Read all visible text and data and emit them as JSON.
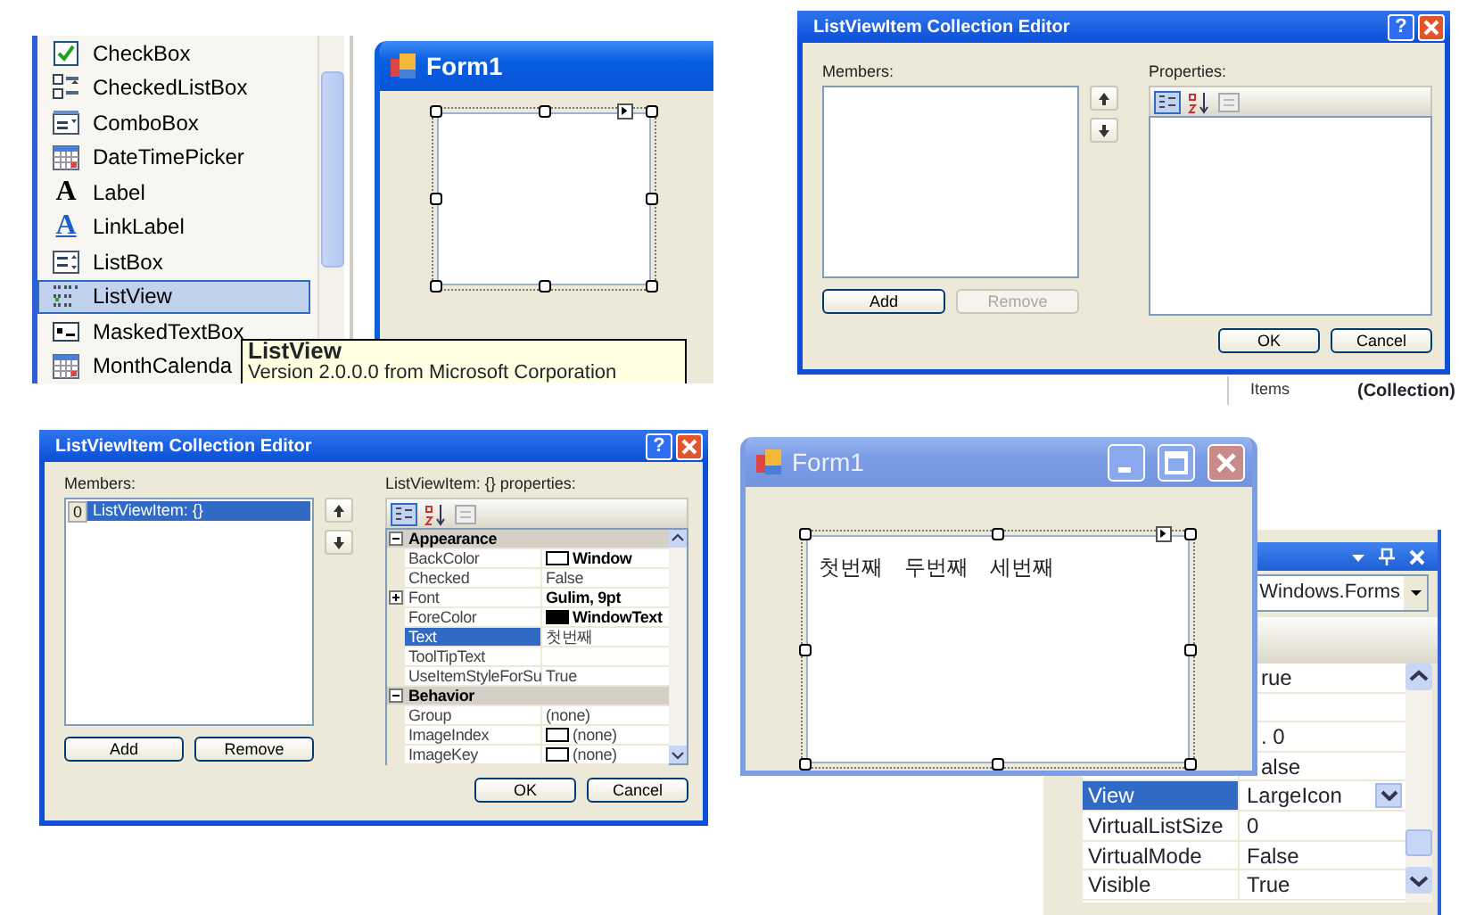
{
  "toolbox": {
    "items": [
      {
        "label": "CheckBox",
        "selected": false
      },
      {
        "label": "CheckedListBox",
        "selected": false
      },
      {
        "label": "ComboBox",
        "selected": false
      },
      {
        "label": "DateTimePicker",
        "selected": false
      },
      {
        "label": "Label",
        "glyph": "A",
        "selected": false
      },
      {
        "label": "LinkLabel",
        "glyph": "A",
        "selected": false
      },
      {
        "label": "ListBox",
        "selected": false
      },
      {
        "label": "ListView",
        "selected": true
      },
      {
        "label": "MaskedTextBox",
        "selected": false
      },
      {
        "label": "MonthCalenda",
        "selected": false
      }
    ]
  },
  "tooltip": {
    "title": "ListView",
    "text": "Version 2.0.0.0 from Microsoft Corporation"
  },
  "designer_form": {
    "title": "Form1"
  },
  "empty_editor": {
    "title": "ListViewItem Collection Editor",
    "help": "?",
    "members_label": "Members:",
    "properties_label": "Properties:",
    "buttons": [
      {
        "label": "Add",
        "disabled": false
      },
      {
        "label": "Remove",
        "disabled": true
      }
    ],
    "ok": "OK",
    "cancel": "Cancel"
  },
  "background_grid": {
    "name": "Items",
    "value": "(Collection)"
  },
  "item_editor": {
    "title": "ListViewItem Collection Editor",
    "help": "?",
    "members_label": "Members:",
    "members": [
      {
        "index": "0",
        "label": "ListViewItem: {}",
        "selected": true
      }
    ],
    "properties_label": "ListViewItem: {} properties:",
    "properties": [
      {
        "kind": "category",
        "name": "Appearance",
        "expanded": true
      },
      {
        "kind": "property",
        "name": "BackColor",
        "value": "Window",
        "bold": true,
        "color": "#ffffff",
        "selected": false
      },
      {
        "kind": "property",
        "name": "Checked",
        "value": "False",
        "bold": false,
        "selected": false
      },
      {
        "kind": "property",
        "name": "Font",
        "value": "Gulim, 9pt",
        "bold": true,
        "expandable": true,
        "selected": false
      },
      {
        "kind": "property",
        "name": "ForeColor",
        "value": "WindowText",
        "bold": true,
        "color": "#000000",
        "selected": false
      },
      {
        "kind": "property",
        "name": "Text",
        "value": "첫번째",
        "bold": false,
        "selected": true
      },
      {
        "kind": "property",
        "name": "ToolTipText",
        "selected": false
      },
      {
        "kind": "property",
        "name": "UseItemStyleForSu",
        "value": "True",
        "bold": false,
        "selected": false
      },
      {
        "kind": "category",
        "name": "Behavior",
        "expanded": true
      },
      {
        "kind": "property",
        "name": "Group",
        "value": "(none)",
        "bold": false,
        "selected": false
      },
      {
        "kind": "property",
        "name": "ImageIndex",
        "value": "(none)",
        "bold": false,
        "color": "#ffffff",
        "selected": false
      },
      {
        "kind": "property",
        "name": "ImageKey",
        "value": "(none)",
        "bold": false,
        "color": "#ffffff",
        "selected": false
      }
    ],
    "buttons": [
      {
        "label": "Add",
        "disabled": false
      },
      {
        "label": "Remove",
        "disabled": false
      }
    ],
    "ok": "OK",
    "cancel": "Cancel"
  },
  "running_form": {
    "title": "Form1",
    "items": [
      {
        "label": "첫번째"
      },
      {
        "label": "두번째"
      },
      {
        "label": "세번째"
      }
    ]
  },
  "properties_window": {
    "object": "Windows.Forms",
    "properties": [
      {
        "kind": "covered",
        "value": "rue"
      },
      {
        "kind": "covered"
      },
      {
        "kind": "covered",
        "value": ". 0"
      },
      {
        "kind": "covered",
        "value": "alse"
      },
      {
        "kind": "property",
        "name": "View",
        "value": "LargeIcon",
        "selected": true,
        "dropdown": true
      },
      {
        "kind": "property",
        "name": "VirtualListSize",
        "value": "0",
        "selected": false,
        "dropdown": false
      },
      {
        "kind": "property",
        "name": "VirtualMode",
        "value": "False",
        "selected": false,
        "dropdown": false
      },
      {
        "kind": "property",
        "name": "Visible",
        "value": "True",
        "selected": false,
        "dropdown": false
      }
    ]
  }
}
